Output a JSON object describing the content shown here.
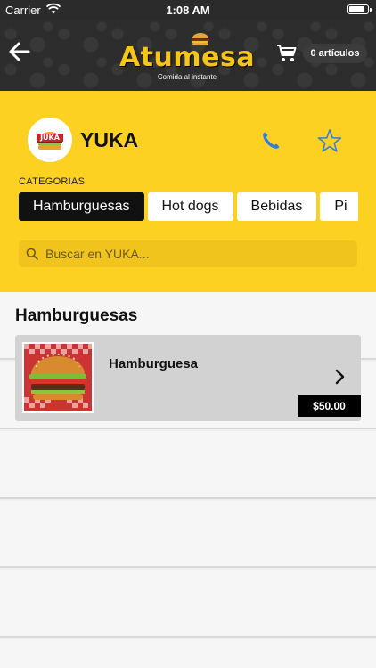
{
  "status_bar": {
    "carrier": "Carrier",
    "time": "1:08 AM"
  },
  "nav": {
    "brand": "Atumesa",
    "tagline": "Comida al instante",
    "cart_count": "0 artículos"
  },
  "restaurant": {
    "name": "YUKA",
    "logo_text": "JUKA",
    "categories_label": "CATEGORIAS",
    "categories": [
      {
        "label": "Hamburguesas",
        "active": true
      },
      {
        "label": "Hot dogs",
        "active": false
      },
      {
        "label": "Bebidas",
        "active": false
      },
      {
        "label": "Pi",
        "active": false
      }
    ],
    "search_placeholder": "Buscar en YUKA..."
  },
  "menu": {
    "section_title": "Hamburguesas",
    "products": [
      {
        "name": "Hamburguesa",
        "price": "$50.00"
      }
    ]
  },
  "colors": {
    "brand_yellow": "#fcd121",
    "navbar_dark": "#2d2d2d",
    "phone_blue": "#2f7fe0"
  },
  "icons": [
    "back-arrow-icon",
    "cart-icon",
    "phone-icon",
    "star-outline-icon",
    "search-icon",
    "chevron-right-icon",
    "wifi-icon",
    "battery-icon"
  ]
}
